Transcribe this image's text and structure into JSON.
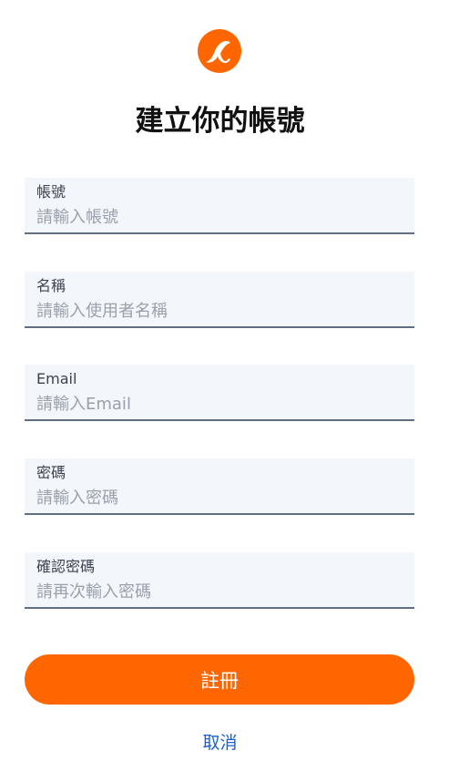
{
  "logo": {
    "icon": "alpha-logo-icon",
    "color": "#ff6600"
  },
  "page_title": "建立你的帳號",
  "form": {
    "fields": [
      {
        "label": "帳號",
        "placeholder": "請輸入帳號",
        "value": ""
      },
      {
        "label": "名稱",
        "placeholder": "請輸入使用者名稱",
        "value": ""
      },
      {
        "label": "Email",
        "placeholder": "請輸入Email",
        "value": ""
      },
      {
        "label": "密碼",
        "placeholder": "請輸入密碼",
        "value": ""
      },
      {
        "label": "確認密碼",
        "placeholder": "請再次輸入密碼",
        "value": ""
      }
    ],
    "submit_label": "註冊",
    "cancel_label": "取消"
  },
  "colors": {
    "accent": "#ff6600",
    "field_background": "#f3f6fa",
    "field_underline": "#5f6e82",
    "link": "#1a5fd1"
  }
}
